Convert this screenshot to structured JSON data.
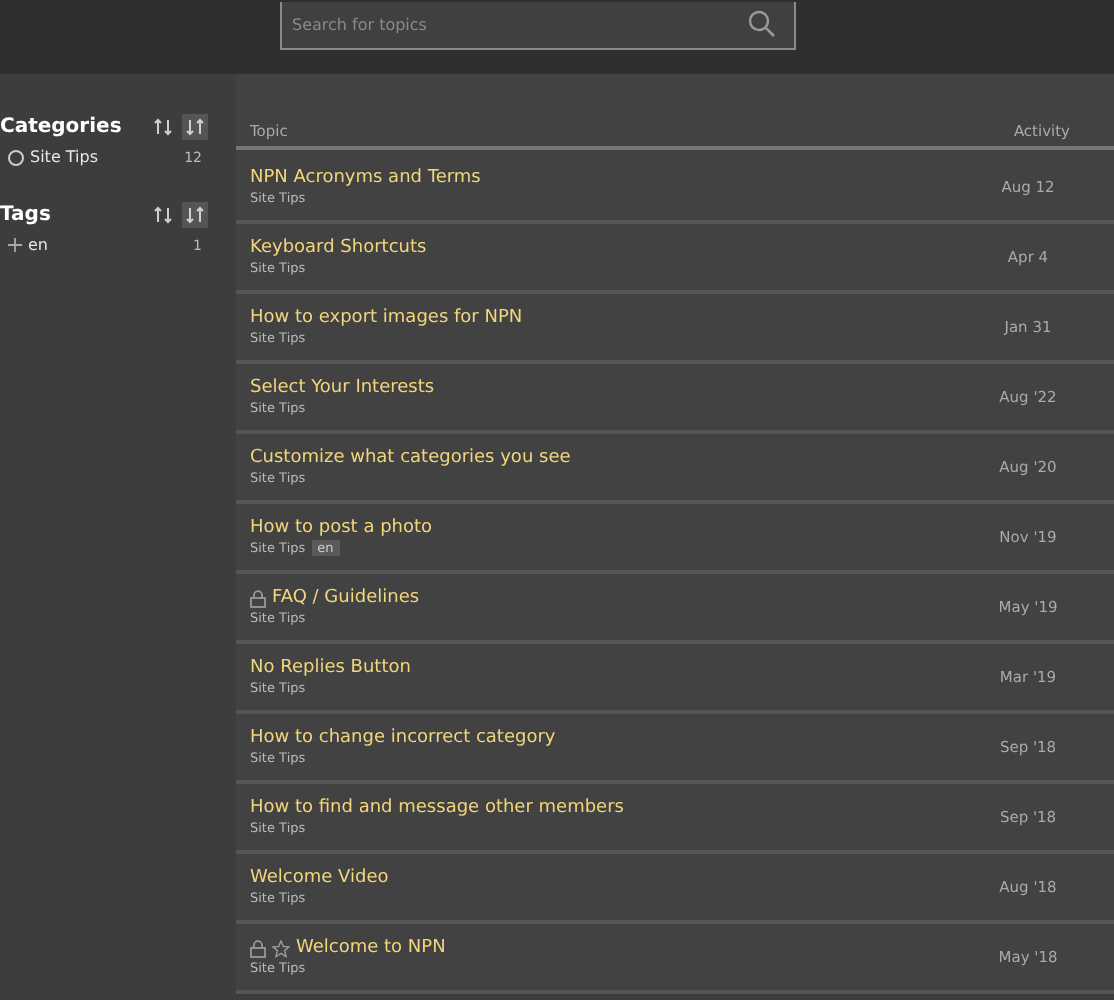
{
  "search": {
    "placeholder": "Search for topics"
  },
  "sidebar": {
    "sections": [
      {
        "title": "Categories",
        "sort_buttons": [
          {
            "selected": false
          },
          {
            "selected": true
          }
        ],
        "items": [
          {
            "kind": "category",
            "label": "Site Tips",
            "count": "12"
          }
        ]
      },
      {
        "title": "Tags",
        "sort_buttons": [
          {
            "selected": false
          },
          {
            "selected": true
          }
        ],
        "items": [
          {
            "kind": "tag",
            "label": "en",
            "count": "1"
          }
        ]
      }
    ]
  },
  "table": {
    "columns": [
      "Topic",
      "Activity"
    ],
    "rows": [
      {
        "title": "NPN Acronyms and Terms",
        "category": "Site Tips",
        "tags": [],
        "locked": false,
        "pinned": false,
        "activity": "Aug 12"
      },
      {
        "title": "Keyboard Shortcuts",
        "category": "Site Tips",
        "tags": [],
        "locked": false,
        "pinned": false,
        "activity": "Apr 4"
      },
      {
        "title": "How to export images for NPN",
        "category": "Site Tips",
        "tags": [],
        "locked": false,
        "pinned": false,
        "activity": "Jan 31"
      },
      {
        "title": "Select Your Interests",
        "category": "Site Tips",
        "tags": [],
        "locked": false,
        "pinned": false,
        "activity": "Aug '22"
      },
      {
        "title": "Customize what categories you see",
        "category": "Site Tips",
        "tags": [],
        "locked": false,
        "pinned": false,
        "activity": "Aug '20"
      },
      {
        "title": "How to post a photo",
        "category": "Site Tips",
        "tags": [
          "en"
        ],
        "locked": false,
        "pinned": false,
        "activity": "Nov '19"
      },
      {
        "title": "FAQ / Guidelines",
        "category": "Site Tips",
        "tags": [],
        "locked": true,
        "pinned": false,
        "activity": "May '19"
      },
      {
        "title": "No Replies Button",
        "category": "Site Tips",
        "tags": [],
        "locked": false,
        "pinned": false,
        "activity": "Mar '19"
      },
      {
        "title": "How to change incorrect category",
        "category": "Site Tips",
        "tags": [],
        "locked": false,
        "pinned": false,
        "activity": "Sep '18"
      },
      {
        "title": "How to find and message other members",
        "category": "Site Tips",
        "tags": [],
        "locked": false,
        "pinned": false,
        "activity": "Sep '18"
      },
      {
        "title": "Welcome Video",
        "category": "Site Tips",
        "tags": [],
        "locked": false,
        "pinned": false,
        "activity": "Aug '18"
      },
      {
        "title": "Welcome to NPN",
        "category": "Site Tips",
        "tags": [],
        "locked": true,
        "pinned": true,
        "activity": "May '18"
      }
    ]
  }
}
